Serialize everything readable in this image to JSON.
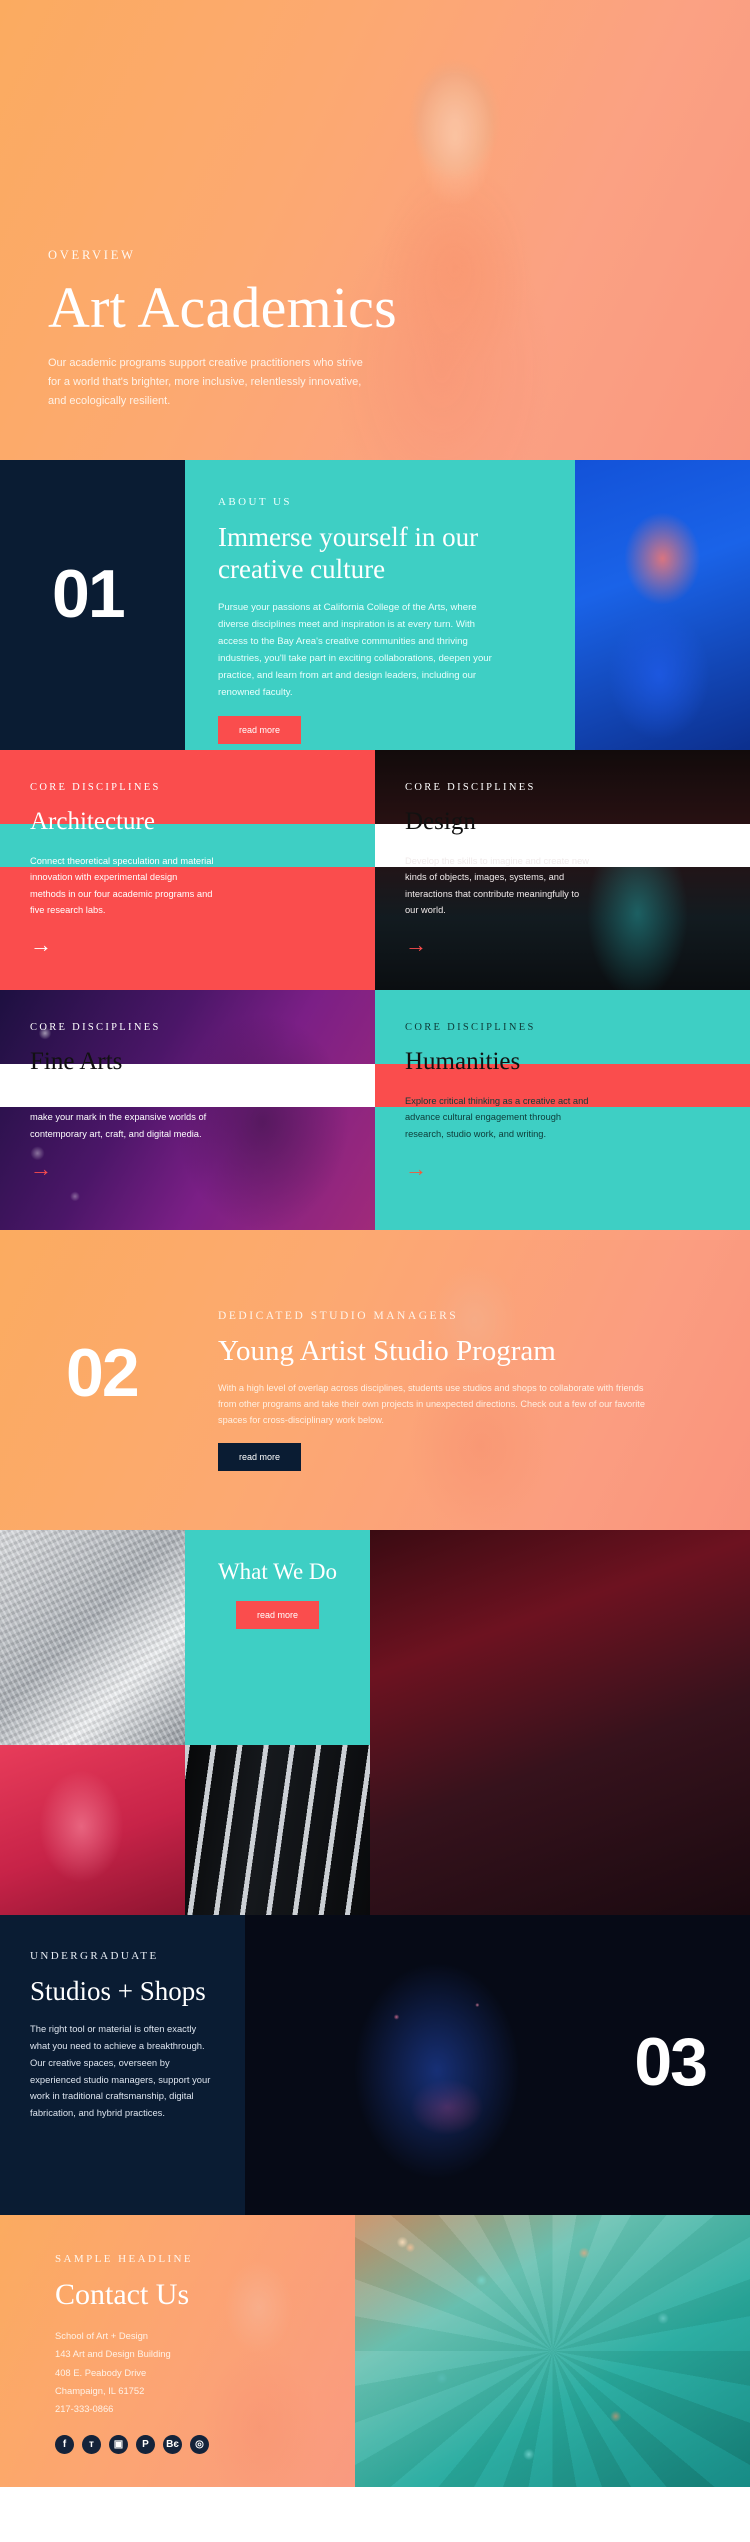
{
  "hero": {
    "eyebrow": "OVERVIEW",
    "title": "Art Academics",
    "paragraph": "Our academic programs support creative practitioners who strive for a world that's brighter, more inclusive, relentlessly innovative, and ecologically resilient."
  },
  "section01": {
    "number": "01",
    "eyebrow": "ABOUT US",
    "title": "Immerse yourself in our creative culture",
    "paragraph": "Pursue your passions at California College of the Arts, where diverse disciplines meet and inspiration is at every turn. With access to the Bay Area's creative communities and thriving industries, you'll take part in exciting collaborations, deepen your practice, and learn from art and design leaders, including our renowned faculty.",
    "button": "read more"
  },
  "disciplines": [
    {
      "eyebrow": "CORE DISCIPLINES",
      "title": "Architecture",
      "paragraph": "Connect theoretical speculation and material innovation with experimental design methods in our four academic programs and five research labs.",
      "arrow": "→"
    },
    {
      "eyebrow": "CORE DISCIPLINES",
      "title": "Design",
      "paragraph": "Develop the skills to imagine and create new kinds of objects, images, systems, and interactions that contribute meaningfully to our world.",
      "arrow": "→"
    },
    {
      "eyebrow": "CORE DISCIPLINES",
      "title": "Fine Arts",
      "paragraph": "Find your voice, identify your audience, and make your mark in the expansive worlds of contemporary art, craft, and digital media.",
      "arrow": "→"
    },
    {
      "eyebrow": "CORE DISCIPLINES",
      "title": "Humanities",
      "paragraph": "Explore critical thinking as a creative act and advance cultural engagement through research, studio work, and writing.",
      "arrow": "→"
    }
  ],
  "section02": {
    "number": "02",
    "eyebrow": "DEDICATED STUDIO MANAGERS",
    "title": "Young Artist Studio Program",
    "paragraph": "With a high level of overlap across disciplines, students use studios and shops to collaborate with friends from other programs and take their own projects in unexpected directions. Check out a few of our favorite spaces for cross-disciplinary work below.",
    "button": "read more"
  },
  "gallery": {
    "title": "What We Do",
    "button": "read more"
  },
  "section03": {
    "number": "03",
    "eyebrow": "UNDERGRADUATE",
    "title": "Studios + Shops",
    "paragraph": "The right tool or material is often exactly what you need to achieve a breakthrough. Our creative spaces, overseen by experienced studio managers, support your work in traditional craftsmanship, digital fabrication, and hybrid practices."
  },
  "footer": {
    "eyebrow": "SAMPLE HEADLINE",
    "title": "Contact Us",
    "address": [
      "School of Art + Design",
      "143 Art and Design Building",
      "408 E. Peabody Drive",
      "Champaign, IL 61752",
      "217-333-0866"
    ],
    "social": [
      {
        "name": "facebook-icon",
        "glyph": "f"
      },
      {
        "name": "twitter-icon",
        "glyph": "ᴛ"
      },
      {
        "name": "instagram-icon",
        "glyph": "▣"
      },
      {
        "name": "pinterest-icon",
        "glyph": "P"
      },
      {
        "name": "behance-icon",
        "glyph": "Bє"
      },
      {
        "name": "dribbble-icon",
        "glyph": "◎"
      }
    ]
  },
  "colors": {
    "orange": "#fbab60",
    "salmon": "#f9977f",
    "red": "#fa4d4d",
    "teal": "#3ecfc4",
    "navy": "#0a1c33",
    "white": "#ffffff"
  }
}
